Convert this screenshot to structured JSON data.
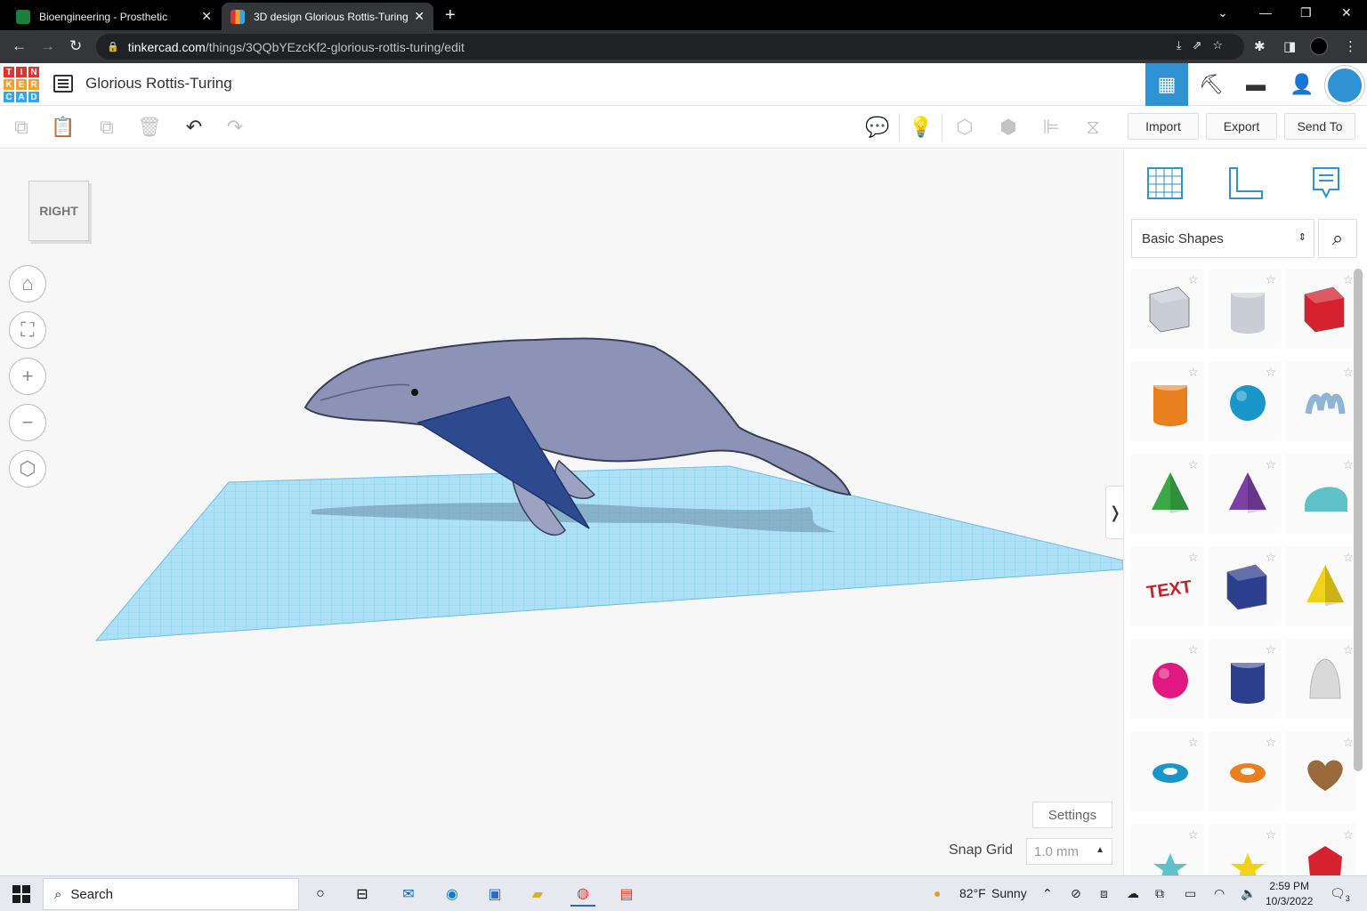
{
  "browser": {
    "tabs": [
      {
        "title": "Bioengineering - Prosthetic",
        "icon": "classroom-icon"
      },
      {
        "title": "3D design Glorious Rottis-Turing",
        "icon": "tinkercad-icon"
      }
    ],
    "url_host": "tinkercad.com",
    "url_path": "/things/3QQbYEzcKf2-glorious-rottis-turing/edit"
  },
  "header": {
    "logo_letters": [
      "T",
      "I",
      "N",
      "K",
      "E",
      "R",
      "C",
      "A",
      "D"
    ],
    "logo_colors": [
      "#e0332f",
      "#e0332f",
      "#e0332f",
      "#f6a12b",
      "#f6a12b",
      "#f6a12b",
      "#37a6e8",
      "#37a6e8",
      "#37a6e8"
    ],
    "design_title": "Glorious Rottis-Turing",
    "accent": "#2e92d3"
  },
  "toolbar": {
    "import_label": "Import",
    "export_label": "Export",
    "send_to_label": "Send To"
  },
  "workplane": {
    "viewcube_label": "RIGHT",
    "settings_label": "Settings",
    "snap_grid_label": "Snap Grid",
    "snap_grid_value": "1.0 mm"
  },
  "panel": {
    "category": "Basic Shapes",
    "shapes": [
      {
        "name": "box-hole",
        "color": "#c9ced6"
      },
      {
        "name": "cylinder-hole",
        "color": "#c9ced6"
      },
      {
        "name": "box",
        "color": "#d6222e"
      },
      {
        "name": "cylinder",
        "color": "#e8801f"
      },
      {
        "name": "sphere",
        "color": "#1a97c9"
      },
      {
        "name": "scribble",
        "color": "#8fb4d6"
      },
      {
        "name": "roof",
        "color": "#39a845"
      },
      {
        "name": "cone",
        "color": "#7b3fa5"
      },
      {
        "name": "round-roof",
        "color": "#5fc1c9"
      },
      {
        "name": "text",
        "color": "#c8202b"
      },
      {
        "name": "wedge",
        "color": "#2c3f8f"
      },
      {
        "name": "pyramid",
        "color": "#f0d218"
      },
      {
        "name": "half-sphere",
        "color": "#e0187f"
      },
      {
        "name": "polygon",
        "color": "#2c3f8f"
      },
      {
        "name": "paraboloid",
        "color": "#d9d9d9"
      },
      {
        "name": "torus",
        "color": "#1a97c9"
      },
      {
        "name": "tube",
        "color": "#e8801f"
      },
      {
        "name": "heart",
        "color": "#9b6a3c"
      },
      {
        "name": "star",
        "color": "#5fc1c9"
      },
      {
        "name": "star-yellow",
        "color": "#f0d218"
      },
      {
        "name": "icosahedron",
        "color": "#d6222e"
      }
    ]
  },
  "taskbar": {
    "search_label": "Search",
    "weather_temp": "82°F",
    "weather_desc": "Sunny",
    "time": "2:59 PM",
    "date": "10/3/2022",
    "notification_count": "3"
  }
}
